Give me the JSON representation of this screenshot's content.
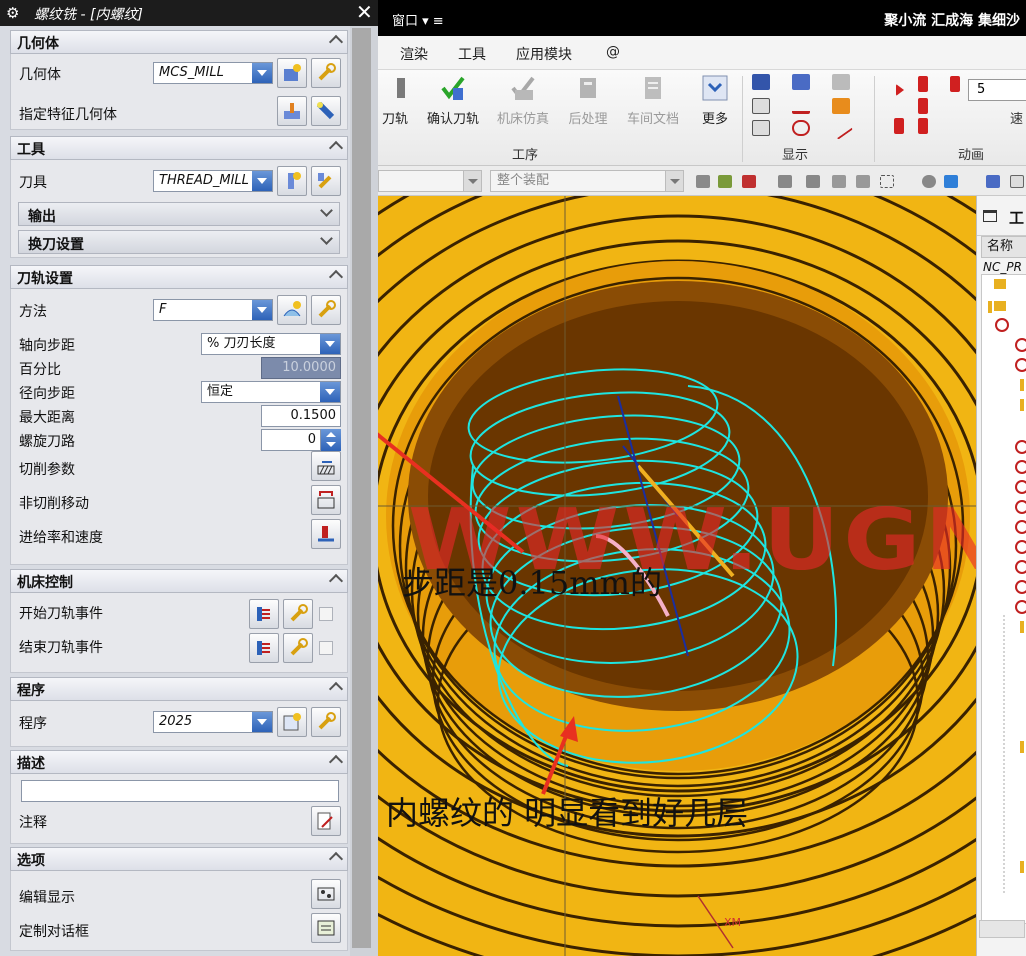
{
  "app": {
    "window_menu": "窗口 ▾ ≡",
    "title_right": "聚小流 汇成海 集细沙",
    "menus": [
      "渲染",
      "工具",
      "应用模块",
      "@"
    ],
    "ribbon": {
      "buttons": [
        "刀轨",
        "确认刀轨",
        "机床仿真",
        "后处理",
        "车间文档",
        "更多"
      ],
      "groups": [
        "工序",
        "显示",
        "动画"
      ],
      "anim_value": "5",
      "anim_speed": "速"
    },
    "toolbar2": {
      "combo2": "整个装配"
    }
  },
  "viewport": {
    "watermark": "WWW.UGNX.NET",
    "note1": "步距是0.15mm的",
    "note2": "内螺纹的  明显看到好几层",
    "axis_label": "XM"
  },
  "navigator": {
    "title": "工",
    "column": "名称",
    "root": "NC_PR"
  },
  "dialog": {
    "title": "螺纹铣 - [内螺纹]",
    "sections": {
      "geometry": {
        "header": "几何体",
        "geometry_label": "几何体",
        "geometry_value": "MCS_MILL",
        "feature_label": "指定特征几何体"
      },
      "tool": {
        "header": "工具",
        "tool_label": "刀具",
        "tool_value": "THREAD_MILL",
        "output": "输出",
        "tool_change": "换刀设置"
      },
      "path": {
        "header": "刀轨设置",
        "method_label": "方法",
        "method_value": "F",
        "axial_step_label": "轴向步距",
        "axial_step_value": "% 刀刃长度",
        "percent_label": "百分比",
        "percent_value": "10.0000",
        "radial_step_label": "径向步距",
        "radial_step_value": "恒定",
        "max_dist_label": "最大距离",
        "max_dist_value": "0.1500",
        "helix_label": "螺旋刀路",
        "helix_value": "0",
        "cut_params": "切削参数",
        "non_cut": "非切削移动",
        "feeds": "进给率和速度"
      },
      "machine": {
        "header": "机床控制",
        "start_event": "开始刀轨事件",
        "end_event": "结束刀轨事件"
      },
      "program": {
        "header": "程序",
        "program_label": "程序",
        "program_value": "2025"
      },
      "description": {
        "header": "描述",
        "comment_label": "注释"
      },
      "options": {
        "header": "选项",
        "edit_display": "编辑显示",
        "custom_dialog": "定制对话框"
      }
    }
  },
  "colors": {
    "viewport_yellow": "#f1b513",
    "thread_orange": "#ee9a00",
    "toolpath_cyan": "#1ee5e0",
    "watermark_red": "#e82828",
    "arrow_red": "#e83020",
    "dropdown_blue": "#2d62b8"
  }
}
